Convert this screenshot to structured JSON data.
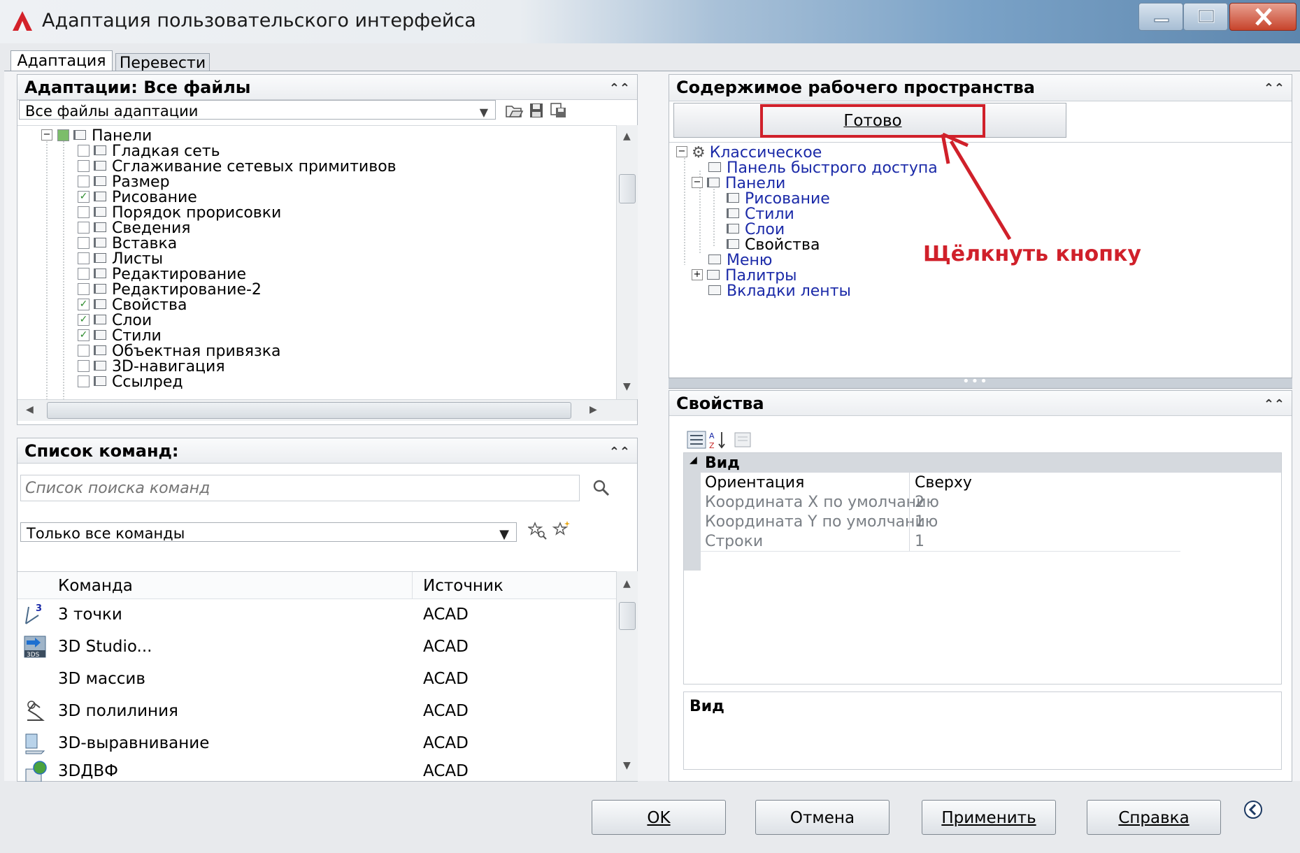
{
  "window": {
    "title": "Адаптация пользовательского интерфейса",
    "icons": [
      "autocad-logo-icon",
      "minimize-icon",
      "maximize-icon",
      "close-icon"
    ]
  },
  "tabs": [
    {
      "label": "Адаптация",
      "active": true
    },
    {
      "label": "Перевести",
      "active": false
    }
  ],
  "customizations": {
    "title": "Адаптации: Все файлы",
    "filter_value": "Все файлы адаптации",
    "tree_root": "Панели",
    "tree_items": [
      {
        "label": "Гладкая сеть",
        "checked": false
      },
      {
        "label": "Сглаживание сетевых примитивов",
        "checked": false
      },
      {
        "label": "Размер",
        "checked": false
      },
      {
        "label": "Рисование",
        "checked": true
      },
      {
        "label": "Порядок прорисовки",
        "checked": false
      },
      {
        "label": "Сведения",
        "checked": false
      },
      {
        "label": "Вставка",
        "checked": false
      },
      {
        "label": "Листы",
        "checked": false
      },
      {
        "label": "Редактирование",
        "checked": false
      },
      {
        "label": "Редактирование-2",
        "checked": false
      },
      {
        "label": "Свойства",
        "checked": true
      },
      {
        "label": "Слои",
        "checked": true
      },
      {
        "label": "Стили",
        "checked": true
      },
      {
        "label": "Объектная привязка",
        "checked": false
      },
      {
        "label": "3D-навигация",
        "checked": false
      },
      {
        "label": "Ссылред",
        "checked": false
      }
    ]
  },
  "commands": {
    "title": "Список команд:",
    "search_placeholder": "Список поиска команд",
    "filter_value": "Только все команды",
    "col_command": "Команда",
    "col_source": "Источник",
    "rows": [
      {
        "name": "3 точки",
        "source": "ACAD",
        "icon": "3-points-icon"
      },
      {
        "name": "3D Studio...",
        "source": "ACAD",
        "icon": "3ds-icon"
      },
      {
        "name": "3D массив",
        "source": "ACAD",
        "icon": ""
      },
      {
        "name": "3D полилиния",
        "source": "ACAD",
        "icon": "3d-polyline-icon"
      },
      {
        "name": "3D-выравнивание",
        "source": "ACAD",
        "icon": "3d-align-icon"
      },
      {
        "name": "3DДВФ",
        "source": "ACAD",
        "icon": "3ddwf-icon"
      }
    ]
  },
  "workspace": {
    "title": "Содержимое рабочего пространства",
    "done_button": "Готово",
    "tree": {
      "root": "Классическое",
      "quick_access": "Панель быстрого доступа",
      "toolbars": "Панели",
      "toolbar_items": [
        "Рисование",
        "Стили",
        "Слои",
        "Свойства"
      ],
      "menu": "Меню",
      "palettes": "Палитры",
      "ribbon_tabs": "Вкладки ленты"
    },
    "annotation": "Щёлкнуть кнопку",
    "annotation_color": "#d0202a"
  },
  "properties": {
    "title": "Свойства",
    "category": "Вид",
    "rows": [
      {
        "name": "Ориентация",
        "value": "Сверху",
        "enabled": true
      },
      {
        "name": "Координата X по умолчанию",
        "value": "2",
        "enabled": false
      },
      {
        "name": "Координата Y по умолчанию",
        "value": "1",
        "enabled": false
      },
      {
        "name": "Строки",
        "value": "1",
        "enabled": false
      }
    ],
    "description_title": "Вид"
  },
  "buttons": {
    "ok": "OK",
    "cancel": "Отмена",
    "apply": "Применить",
    "help": "Справка"
  }
}
